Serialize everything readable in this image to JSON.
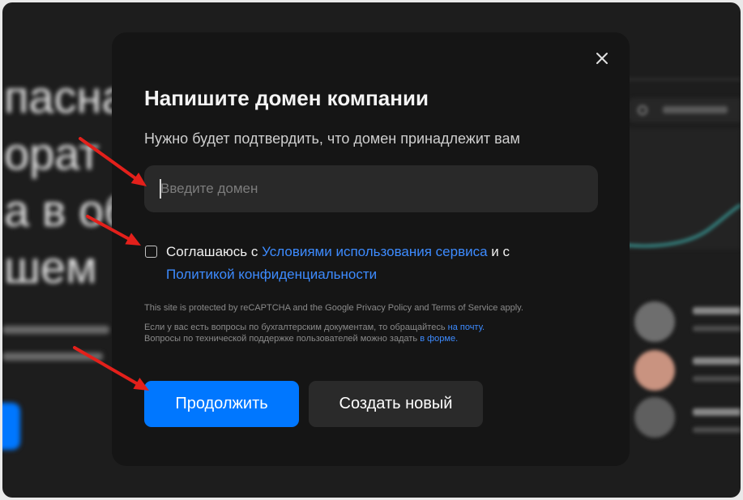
{
  "colors": {
    "accent": "#0077ff",
    "link": "#3d8bff",
    "modal_bg": "#151515",
    "annotation_arrow": "#e3201b"
  },
  "icons": {
    "close": "close-icon",
    "consent_checkbox": "checkbox-unchecked",
    "annotation": "red-arrow"
  },
  "background": {
    "headline_fragments": [
      "пасна",
      "орат",
      "а в об",
      "шем"
    ]
  },
  "modal": {
    "title": "Напишите домен компании",
    "subtitle": "Нужно будет подтвердить, что домен принадлежит вам",
    "domain_input": {
      "value": "",
      "placeholder": "Введите домен"
    },
    "consent": {
      "checked": false,
      "prefix": "Соглашаюсь с ",
      "terms_link": "Условиями использования сервиса",
      "suffix": " и с",
      "privacy_link": "Политикой конфиденциальности"
    },
    "recaptcha_notice": "This site is protected by reCAPTCHA and the Google Privacy Policy and Terms of Service apply.",
    "support": {
      "billing_text": "Если у вас есть вопросы по бухгалтерским документам, то обращайтесь ",
      "billing_link": "на почту.",
      "tech_text": "Вопросы по технической поддержке пользователей можно задать ",
      "tech_link": "в форме."
    },
    "buttons": {
      "continue": "Продолжить",
      "create_new": "Создать новый"
    }
  }
}
